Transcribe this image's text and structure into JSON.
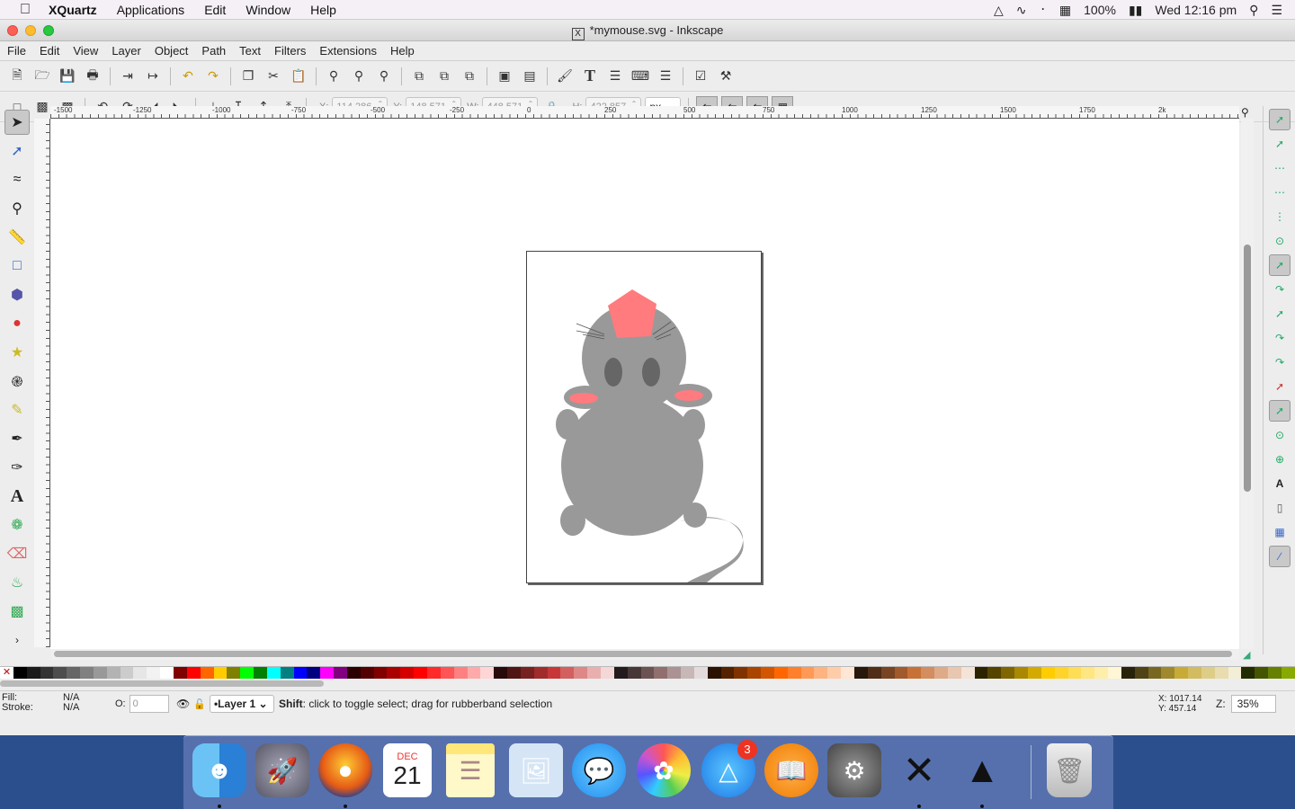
{
  "menubar": {
    "app_name": "XQuartz",
    "items": [
      "Applications",
      "Edit",
      "Window",
      "Help"
    ],
    "status": {
      "battery": "100%",
      "clock": "Wed 12:16 pm"
    }
  },
  "window": {
    "title": "*mymouse.svg - Inkscape"
  },
  "app_menu": [
    "File",
    "Edit",
    "View",
    "Layer",
    "Object",
    "Path",
    "Text",
    "Filters",
    "Extensions",
    "Help"
  ],
  "selector_toolbar": {
    "x_label": "X:",
    "x_value": "114.286",
    "y_label": "Y:",
    "y_value": "148.571",
    "w_label": "W:",
    "w_value": "448.571",
    "h_label": "H:",
    "h_value": "422.857",
    "unit": "px"
  },
  "ruler": {
    "labels": [
      "-1500",
      "-1250",
      "-1000",
      "-750",
      "-500",
      "-250",
      "0",
      "250",
      "500",
      "750",
      "1000",
      "1250",
      "1500",
      "1750",
      "2k"
    ]
  },
  "tools": [
    "select-tool",
    "node-tool",
    "tweak-tool",
    "zoom-tool",
    "measure-tool",
    "rect-tool",
    "3dbox-tool",
    "circle-tool",
    "star-tool",
    "spiral-tool",
    "pencil-tool",
    "pen-tool",
    "calligraphy-tool",
    "text-tool",
    "spray-tool",
    "eraser-tool",
    "bucket-tool",
    "gradient-tool"
  ],
  "palette": [
    "#000000",
    "#1a1a1a",
    "#333333",
    "#4d4d4d",
    "#666666",
    "#808080",
    "#999999",
    "#b3b3b3",
    "#cccccc",
    "#e6e6e6",
    "#f2f2f2",
    "#ffffff",
    "#800000",
    "#ff0000",
    "#ff6600",
    "#ffcc00",
    "#808000",
    "#00ff00",
    "#008000",
    "#00ffff",
    "#008080",
    "#0000ff",
    "#000080",
    "#ff00ff",
    "#800080",
    "#2b0000",
    "#550000",
    "#800000",
    "#aa0000",
    "#d40000",
    "#ff0000",
    "#ff2a2a",
    "#ff5555",
    "#ff8080",
    "#ffaaaa",
    "#ffd5d5",
    "#280b0b",
    "#501616",
    "#782121",
    "#a02c2c",
    "#c83737",
    "#d35f5f",
    "#de8787",
    "#e9afaf",
    "#f4d7d7",
    "#241c1c",
    "#483737",
    "#6c5353",
    "#916f6f",
    "#ac9393",
    "#c8b7b7",
    "#e3dbdb",
    "#2b1100",
    "#552200",
    "#803300",
    "#aa4400",
    "#d45500",
    "#ff6600",
    "#ff7f2a",
    "#ff9955",
    "#ffb380",
    "#ffccaa",
    "#ffe6d5",
    "#28170b",
    "#502d16",
    "#784421",
    "#a05a2c",
    "#c87137",
    "#d38d5f",
    "#deaa87",
    "#e9c6af",
    "#f4e3d7",
    "#2b2200",
    "#554400",
    "#806600",
    "#aa8800",
    "#d4aa00",
    "#ffcc00",
    "#ffd42a",
    "#ffdd55",
    "#ffe680",
    "#ffeeaa",
    "#fff6d5",
    "#28220b",
    "#504416",
    "#786721",
    "#a0892c",
    "#c8ab37",
    "#d3bc5f",
    "#decd87",
    "#e9ddaf",
    "#f4eed7",
    "#222b00",
    "#445500",
    "#668000",
    "#88aa00"
  ],
  "status": {
    "fill_label": "Fill:",
    "fill_value": "N/A",
    "stroke_label": "Stroke:",
    "stroke_value": "N/A",
    "opacity_label": "O:",
    "opacity_value": "0",
    "layer": "•Layer 1",
    "message_key": "Shift",
    "message_rest": ": click to toggle select; drag for rubberband selection",
    "x_coord": "X: 1017.14",
    "y_coord": "Y:  457.14",
    "zoom_label": "Z:",
    "zoom_value": "35%"
  },
  "dock": {
    "apps": [
      "Finder",
      "Launchpad",
      "Firefox",
      "Calendar",
      "Notes",
      "Preview",
      "Messages",
      "Photos",
      "App Store",
      "iBooks",
      "System Preferences",
      "X11",
      "Inkscape",
      "Trash"
    ],
    "calendar_month": "DEC",
    "calendar_day": "21",
    "appstore_badge": "3"
  }
}
